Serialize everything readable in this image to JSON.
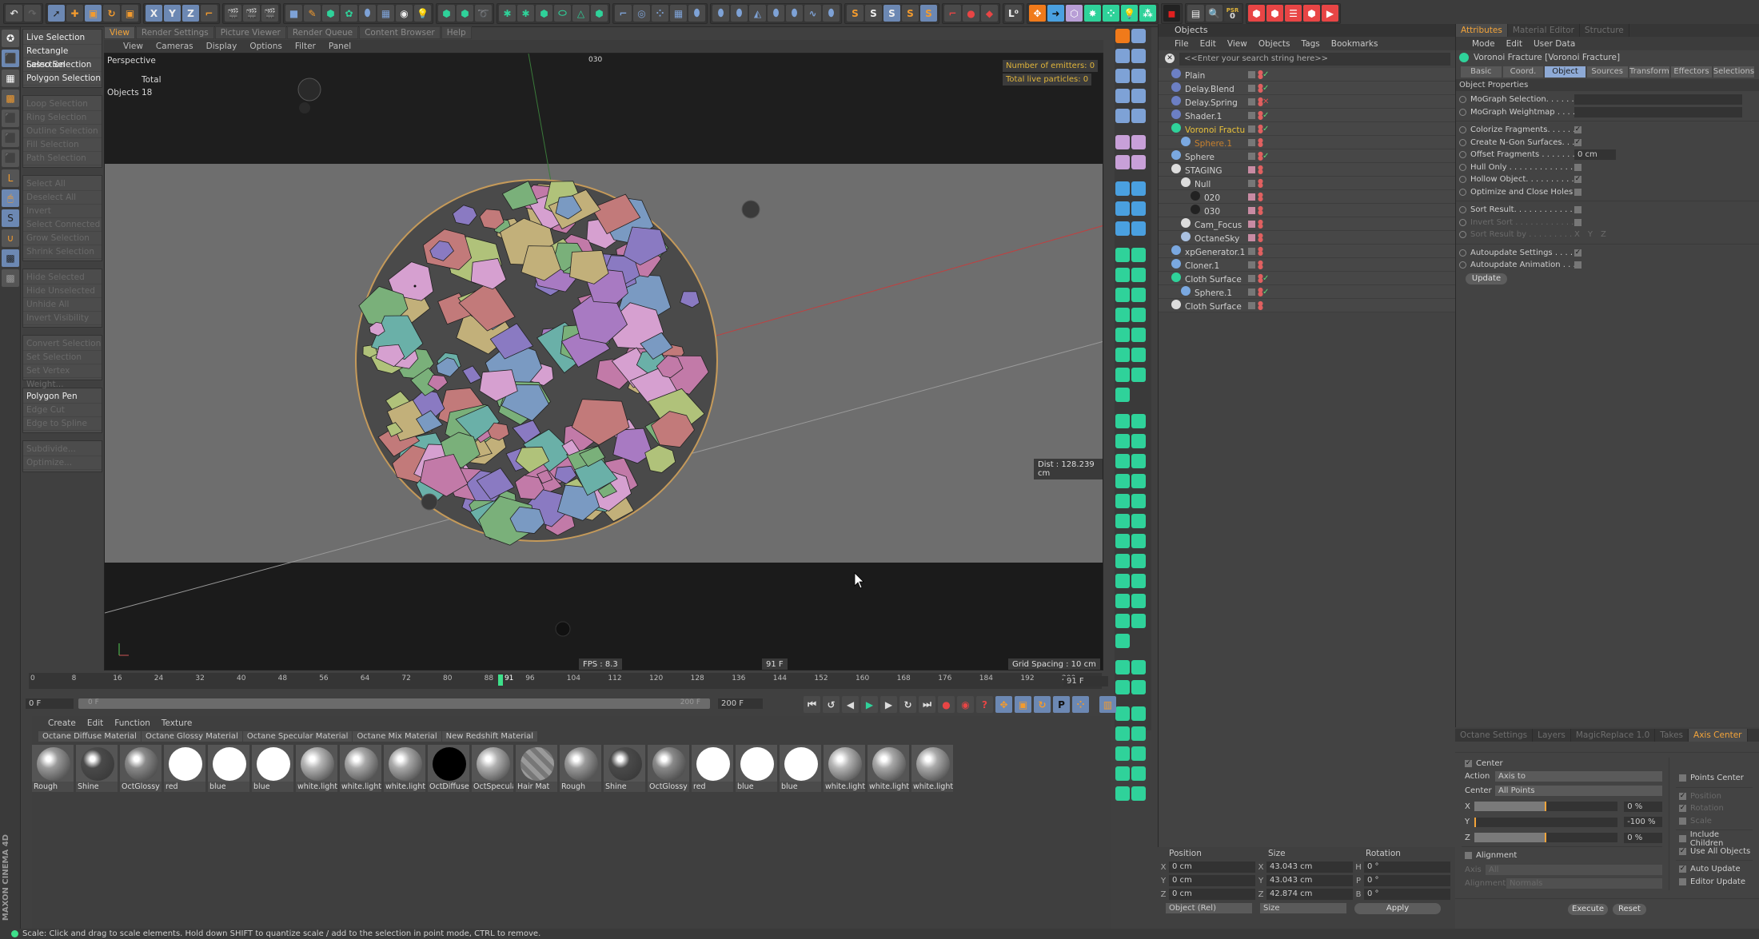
{
  "toolbar": {
    "coord_labels": [
      "X",
      "Y",
      "Z"
    ],
    "psr_label": "PSR",
    "psr_value": "0"
  },
  "selection_menu": {
    "groups": [
      [
        {
          "label": "Live Selection",
          "enabled": true
        },
        {
          "label": "Rectangle Selection",
          "enabled": true
        },
        {
          "label": "Lasso Selection",
          "enabled": true
        },
        {
          "label": "Polygon Selection",
          "enabled": true
        }
      ],
      [
        {
          "label": "Loop Selection",
          "enabled": false
        },
        {
          "label": "Ring Selection",
          "enabled": false
        },
        {
          "label": "Outline Selection",
          "enabled": false
        },
        {
          "label": "Fill Selection",
          "enabled": false
        },
        {
          "label": "Path Selection",
          "enabled": false
        }
      ],
      [
        {
          "label": "Select All",
          "enabled": false
        },
        {
          "label": "Deselect All",
          "enabled": false
        },
        {
          "label": "Invert",
          "enabled": false
        },
        {
          "label": "Select Connected",
          "enabled": false
        },
        {
          "label": "Grow Selection",
          "enabled": false
        },
        {
          "label": "Shrink Selection",
          "enabled": false
        }
      ],
      [
        {
          "label": "Hide Selected",
          "enabled": false
        },
        {
          "label": "Hide Unselected",
          "enabled": false
        },
        {
          "label": "Unhide All",
          "enabled": false
        },
        {
          "label": "Invert Visibility",
          "enabled": false
        }
      ],
      [
        {
          "label": "Convert Selection",
          "enabled": false
        },
        {
          "label": "Set Selection",
          "enabled": false
        },
        {
          "label": "Set Vertex Weight...",
          "enabled": false
        }
      ],
      [
        {
          "label": "Polygon Pen",
          "enabled": true
        },
        {
          "label": "Edge Cut",
          "enabled": false
        },
        {
          "label": "Edge to Spline",
          "enabled": false
        }
      ],
      [
        {
          "label": "Subdivide...",
          "enabled": false
        },
        {
          "label": "Optimize...",
          "enabled": false
        }
      ]
    ]
  },
  "viewport": {
    "tabs": [
      "View",
      "Render Settings",
      "Picture Viewer",
      "Render Queue",
      "Content Browser",
      "Help"
    ],
    "active_tab": "View",
    "menu": [
      "View",
      "Cameras",
      "Display",
      "Options",
      "Filter",
      "Panel"
    ],
    "camera_label": "Perspective",
    "camera_name": "030",
    "stats_header": "Total",
    "stats_label": "Objects",
    "stats_value": "18",
    "emitters": "Number of emitters: 0",
    "particles": "Total live particles: 0",
    "dist": "Dist : 128.239 cm",
    "fps": "FPS : 8.3",
    "frame": "91 F",
    "grid_spacing": "Grid Spacing : 10 cm"
  },
  "timeline": {
    "ticks": [
      "0",
      "8",
      "16",
      "24",
      "32",
      "40",
      "48",
      "56",
      "64",
      "72",
      "80",
      "88",
      "96",
      "104",
      "112",
      "120",
      "128",
      "136",
      "144",
      "152",
      "160",
      "168",
      "176",
      "184",
      "192",
      "200"
    ],
    "current_frame": "91",
    "current_frame_field": "91 F",
    "start_field": "0 F",
    "range_start": "0 F",
    "range_end": "200 F",
    "end_field": "200 F",
    "playhead_fraction": 0.455
  },
  "materials": {
    "menu": [
      "Create",
      "Edit",
      "Function",
      "Texture"
    ],
    "tabs": [
      "Octane Diffuse Material",
      "Octane Glossy Material",
      "Octane Specular Material",
      "Octane Mix Material",
      "New Redshift Material"
    ],
    "items": [
      {
        "name": "Rough",
        "color": "#9a9a9a"
      },
      {
        "name": "Shine",
        "color": "#4a4a4a"
      },
      {
        "name": "OctGlossy",
        "color": "#8a8a8a"
      },
      {
        "name": "red",
        "color": "#ffffff"
      },
      {
        "name": "blue",
        "color": "#ffffff"
      },
      {
        "name": "blue",
        "color": "#ffffff"
      },
      {
        "name": "white.light",
        "color": "#b5b5b5"
      },
      {
        "name": "white.light",
        "color": "#a8a8a8"
      },
      {
        "name": "white.light",
        "color": "#aaaaaa"
      },
      {
        "name": "OctDiffuse",
        "color": "#000000"
      },
      {
        "name": "OctSpecula",
        "color": "#b0b0b0"
      },
      {
        "name": "Hair Mat",
        "color": "#777777"
      },
      {
        "name": "Rough",
        "color": "#9a9a9a"
      },
      {
        "name": "Shine",
        "color": "#4a4a4a"
      },
      {
        "name": "OctGlossy",
        "color": "#8a8a8a"
      },
      {
        "name": "red",
        "color": "#ffffff"
      },
      {
        "name": "blue",
        "color": "#ffffff"
      },
      {
        "name": "blue",
        "color": "#ffffff"
      },
      {
        "name": "white.light",
        "color": "#b5b5b5"
      },
      {
        "name": "white.light",
        "color": "#a8a8a8"
      },
      {
        "name": "white.light",
        "color": "#aaaaaa"
      }
    ]
  },
  "objects": {
    "title": "Objects",
    "menu": [
      "File",
      "Edit",
      "View",
      "Objects",
      "Tags",
      "Bookmarks"
    ],
    "search_placeholder": "<<Enter your search string here>>",
    "rows": [
      {
        "name": "Plain",
        "depth": 0,
        "icon": "#6c7fc4",
        "layer": "gray",
        "check": "ok",
        "sel": false
      },
      {
        "name": "Delay.Blend",
        "depth": 0,
        "icon": "#6c7fc4",
        "layer": "gray",
        "check": "ok",
        "sel": false
      },
      {
        "name": "Delay.Spring",
        "depth": 0,
        "icon": "#6c7fc4",
        "layer": "gray",
        "check": "x",
        "sel": false
      },
      {
        "name": "Shader.1",
        "depth": 0,
        "icon": "#6c7fc4",
        "layer": "gray",
        "check": "ok",
        "sel": false
      },
      {
        "name": "Voronoi Fracture",
        "depth": 0,
        "icon": "#2fd29a",
        "layer": "gray",
        "check": "ok",
        "sel": "parent"
      },
      {
        "name": "Sphere.1",
        "depth": 1,
        "icon": "#7aa8e0",
        "layer": "gray",
        "check": "",
        "sel": "child"
      },
      {
        "name": "Sphere",
        "depth": 0,
        "icon": "#7aa8e0",
        "layer": "gray",
        "check": "ok",
        "sel": false
      },
      {
        "name": "STAGING",
        "depth": 0,
        "icon": "#dddddd",
        "layer": "pink",
        "check": "",
        "sel": false
      },
      {
        "name": "Null",
        "depth": 1,
        "icon": "#dddddd",
        "layer": "gray",
        "check": "",
        "sel": false
      },
      {
        "name": "020",
        "depth": 2,
        "icon": "#222222",
        "layer": "pink",
        "check": "",
        "sel": false
      },
      {
        "name": "030",
        "depth": 2,
        "icon": "#222222",
        "layer": "pink",
        "check": "",
        "sel": false
      },
      {
        "name": "Cam_Focus",
        "depth": 1,
        "icon": "#dddddd",
        "layer": "pink",
        "check": "",
        "sel": false
      },
      {
        "name": "OctaneSky",
        "depth": 1,
        "icon": "#a9c0e0",
        "layer": "pink",
        "check": "",
        "sel": false
      },
      {
        "name": "xpGenerator.1",
        "depth": 0,
        "icon": "#7aa8e0",
        "layer": "gray",
        "check": "",
        "sel": false
      },
      {
        "name": "Cloner.1",
        "depth": 0,
        "icon": "#7aa8e0",
        "layer": "gray",
        "check": "",
        "sel": false
      },
      {
        "name": "Cloth Surface",
        "depth": 0,
        "icon": "#2fd29a",
        "layer": "gray",
        "check": "ok",
        "sel": false
      },
      {
        "name": "Sphere.1",
        "depth": 1,
        "icon": "#7aa8e0",
        "layer": "gray",
        "check": "ok",
        "sel": false
      },
      {
        "name": "Cloth Surface",
        "depth": 0,
        "icon": "#dddddd",
        "layer": "gray",
        "check": "",
        "sel": false
      }
    ]
  },
  "attributes": {
    "tabs": [
      "Attributes",
      "Material Editor",
      "Structure"
    ],
    "active_tab": "Attributes",
    "menu": [
      "Mode",
      "Edit",
      "User Data"
    ],
    "object_title": "Voronoi Fracture [Voronoi Fracture]",
    "subtabs": [
      "Basic",
      "Coord.",
      "Object",
      "Sources",
      "Transform",
      "Effectors",
      "Selections"
    ],
    "active_subtab": "Object",
    "section": "Object Properties",
    "link_fields": [
      "MoGraph Selection. . . . . .",
      "MoGraph Weightmap . . . ."
    ],
    "props1": [
      {
        "label": "Colorize Fragments. . . . . .",
        "type": "check",
        "value": true
      },
      {
        "label": "Create N-Gon Surfaces. . .",
        "type": "check",
        "value": true
      },
      {
        "label": "Offset Fragments . . . . . . .",
        "type": "field",
        "value": "0 cm"
      },
      {
        "label": "Hull Only . . . . . . . . . . . . .",
        "type": "check",
        "value": false
      },
      {
        "label": "Hollow Object. . . . . . . . . .",
        "type": "check",
        "value": true
      },
      {
        "label": "Optimize and Close Holes",
        "type": "check",
        "value": false
      }
    ],
    "props2": [
      {
        "label": "Sort Result. . . . . . . . . . . .",
        "type": "check",
        "value": false,
        "enabled": true
      },
      {
        "label": "Invert Sort . . . . . . . . . . . .",
        "type": "check",
        "value": false,
        "enabled": false
      },
      {
        "label": "Sort Result by . . . . . . . . .",
        "type": "radio",
        "value": "X",
        "enabled": false
      }
    ],
    "sort_axes": [
      "X",
      "Y",
      "Z"
    ],
    "props3": [
      {
        "label": "Autoupdate Settings . . . . .",
        "type": "check",
        "value": true
      },
      {
        "label": "Autoupdate Animation . . .",
        "type": "check",
        "value": false
      }
    ],
    "update_button": "Update"
  },
  "coordinates": {
    "headers": [
      "Position",
      "Size",
      "Rotation"
    ],
    "rows": [
      {
        "pl": "X",
        "pos": "0 cm",
        "sl": "X",
        "size": "43.043 cm",
        "rl": "H",
        "rot": "0 °"
      },
      {
        "pl": "Y",
        "pos": "0 cm",
        "sl": "Y",
        "size": "43.043 cm",
        "rl": "P",
        "rot": "0 °"
      },
      {
        "pl": "Z",
        "pos": "0 cm",
        "sl": "Z",
        "size": "42.874 cm",
        "rl": "B",
        "rot": "0 °"
      }
    ],
    "mode_select": "Object (Rel)",
    "size_select": "Size",
    "apply_button": "Apply"
  },
  "axis_center": {
    "tabs": [
      "Octane Settings",
      "Layers",
      "MagicReplace 1.0",
      "Takes",
      "Axis Center"
    ],
    "active_tab": "Axis Center",
    "center_label": "Center",
    "center_checked": true,
    "action_label": "Action",
    "action_value": "Axis to",
    "center_sel_label": "Center",
    "center_sel_value": "All Points",
    "sliders": [
      {
        "axis": "X",
        "value": "0 %",
        "fraction": 0.5
      },
      {
        "axis": "Y",
        "value": "-100 %",
        "fraction": 0.0
      },
      {
        "axis": "Z",
        "value": "0 %",
        "fraction": 0.5
      }
    ],
    "alignment_label": "Alignment",
    "alignment_checked": false,
    "axis_field_label": "Axis",
    "axis_field_value": "All",
    "alignment_field_label": "Alignment",
    "alignment_field_value": "Normals",
    "right_options": [
      {
        "label": "Points Center",
        "checked": false,
        "enabled": true
      },
      {
        "label": "Position",
        "checked": true,
        "enabled": false
      },
      {
        "label": "Rotation",
        "checked": true,
        "enabled": false
      },
      {
        "label": "Scale",
        "checked": false,
        "enabled": false
      },
      {
        "label": "Include Children",
        "checked": false,
        "enabled": true
      },
      {
        "label": "Use All Objects",
        "checked": true,
        "enabled": true
      },
      {
        "label": "Auto Update",
        "checked": true,
        "enabled": true
      },
      {
        "label": "Editor Update",
        "checked": false,
        "enabled": true
      }
    ],
    "execute_button": "Execute",
    "reset_button": "Reset"
  },
  "brand": "MAXON CINEMA 4D",
  "status": "Scale: Click and drag to scale elements. Hold down SHIFT to quantize scale / add to the selection in point mode, CTRL to remove.",
  "colors": {
    "accent": "#f3a43a",
    "selection_blue": "#6c88b3",
    "mograph_green": "#2fd29a",
    "active_object": "#e8c13a"
  }
}
